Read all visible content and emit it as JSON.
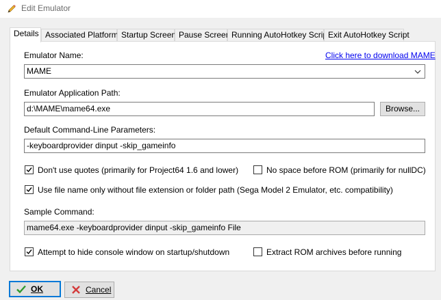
{
  "window": {
    "title": "Edit Emulator"
  },
  "tabs": [
    {
      "label": "Details",
      "active": true
    },
    {
      "label": "Associated Platforms"
    },
    {
      "label": "Startup Screen"
    },
    {
      "label": "Pause Screen"
    },
    {
      "label": "Running AutoHotkey Script"
    },
    {
      "label": "Exit AutoHotkey Script"
    }
  ],
  "details": {
    "emulator_name_label": "Emulator Name:",
    "download_link": "Click here to download MAME",
    "emulator_name_value": "MAME",
    "app_path_label": "Emulator Application Path:",
    "app_path_value": "d:\\MAME\\mame64.exe",
    "browse_label": "Browse...",
    "cmdline_label": "Default Command-Line Parameters:",
    "cmdline_value": "-keyboardprovider dinput -skip_gameinfo",
    "options": {
      "dont_use_quotes": {
        "label": "Don't use quotes (primarily for Project64 1.6 and lower)",
        "checked": true
      },
      "no_space_before_rom": {
        "label": "No space before ROM (primarily for nullDC)",
        "checked": false
      },
      "file_name_only": {
        "label": "Use file name only without file extension or folder path (Sega Model 2 Emulator, etc. compatibility)",
        "checked": true
      },
      "hide_console": {
        "label": "Attempt to hide console window on startup/shutdown",
        "checked": true
      },
      "extract_rom": {
        "label": "Extract ROM archives before running",
        "checked": false
      }
    },
    "sample_command_label": "Sample Command:",
    "sample_command_value": "mame64.exe -keyboardprovider dinput -skip_gameinfo File"
  },
  "footer": {
    "ok_label": "OK",
    "cancel_label": "Cancel"
  },
  "colors": {
    "check_green": "#2e9a2e",
    "cancel_red": "#d33a3a",
    "link_blue": "#0000ee",
    "focus_blue": "#0078d7"
  }
}
